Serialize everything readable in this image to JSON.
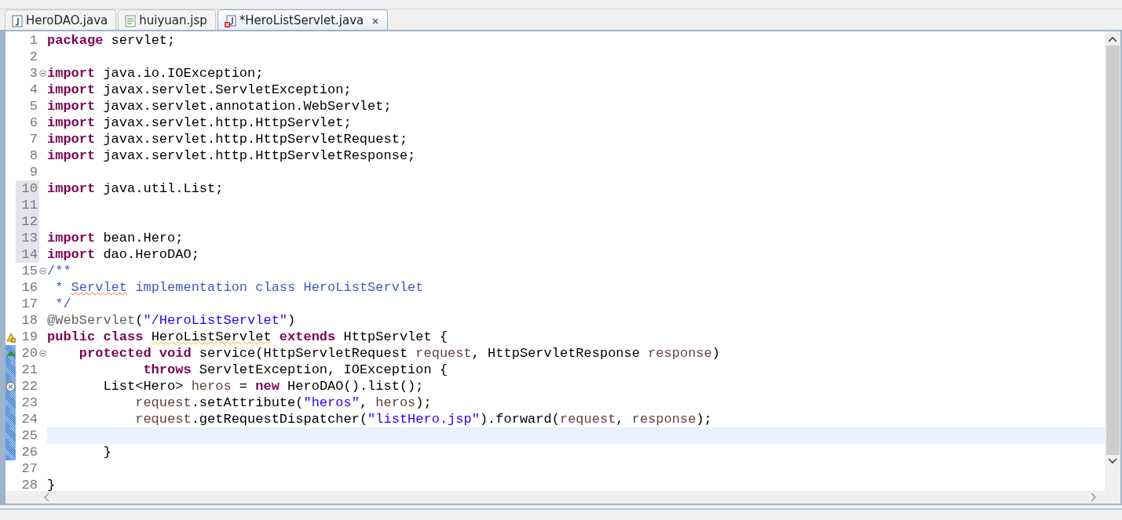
{
  "tabs": [
    {
      "label": "HeroDAO.java",
      "kind": "java",
      "selected": false,
      "closable": false
    },
    {
      "label": "huiyuan.jsp",
      "kind": "jsp",
      "selected": false,
      "closable": false
    },
    {
      "label": "*HeroListServlet.java",
      "kind": "javaerror",
      "selected": true,
      "closable": true
    }
  ],
  "editor": {
    "lines": [
      {
        "n": "1",
        "tokens": [
          {
            "kind": "keyword",
            "t": "package"
          },
          {
            "kind": "plain",
            "t": " servlet;"
          }
        ]
      },
      {
        "n": "2"
      },
      {
        "n": "3",
        "fold": true,
        "tokens": [
          {
            "kind": "keyword",
            "t": "import"
          },
          {
            "kind": "plain",
            "t": " java.io.IOException;"
          }
        ]
      },
      {
        "n": "4",
        "tokens": [
          {
            "kind": "keyword",
            "t": "import"
          },
          {
            "kind": "plain",
            "t": " javax.servlet.ServletException;"
          }
        ]
      },
      {
        "n": "5",
        "tokens": [
          {
            "kind": "keyword",
            "t": "import"
          },
          {
            "kind": "plain",
            "t": " javax.servlet.annotation.WebServlet;"
          }
        ]
      },
      {
        "n": "6",
        "tokens": [
          {
            "kind": "keyword",
            "t": "import"
          },
          {
            "kind": "plain",
            "t": " javax.servlet.http.HttpServlet;"
          }
        ]
      },
      {
        "n": "7",
        "tokens": [
          {
            "kind": "keyword",
            "t": "import"
          },
          {
            "kind": "plain",
            "t": " javax.servlet.http.HttpServletRequest;"
          }
        ]
      },
      {
        "n": "8",
        "tokens": [
          {
            "kind": "keyword",
            "t": "import"
          },
          {
            "kind": "plain",
            "t": " javax.servlet.http.HttpServletResponse;"
          }
        ]
      },
      {
        "n": "9"
      },
      {
        "n": "10",
        "shaded": true,
        "tokens": [
          {
            "kind": "keyword",
            "t": "import"
          },
          {
            "kind": "plain",
            "t": " java.util.List;"
          }
        ]
      },
      {
        "n": "11",
        "shaded": true
      },
      {
        "n": "12",
        "shaded": true
      },
      {
        "n": "13",
        "shaded": true,
        "tokens": [
          {
            "kind": "keyword",
            "t": "import"
          },
          {
            "kind": "plain",
            "t": " bean.Hero;"
          }
        ]
      },
      {
        "n": "14",
        "shaded": true,
        "tokens": [
          {
            "kind": "keyword",
            "t": "import"
          },
          {
            "kind": "plain",
            "t": " dao.HeroDAO;"
          }
        ]
      },
      {
        "n": "15",
        "fold": true,
        "tokens": [
          {
            "kind": "doc",
            "t": "/**"
          }
        ]
      },
      {
        "n": "16",
        "tokens": [
          {
            "kind": "doc",
            "t": " * "
          },
          {
            "kind": "doc",
            "t": "Servlet",
            "misspelled": true
          },
          {
            "kind": "doc",
            "t": " implementation class HeroListServlet"
          }
        ]
      },
      {
        "n": "17",
        "tokens": [
          {
            "kind": "doc",
            "t": " */"
          }
        ]
      },
      {
        "n": "18",
        "tokens": [
          {
            "kind": "annotation",
            "t": "@WebServlet"
          },
          {
            "kind": "plain",
            "t": "("
          },
          {
            "kind": "string",
            "t": "\"/HeroListServlet\""
          },
          {
            "kind": "plain",
            "t": ")"
          }
        ]
      },
      {
        "n": "19",
        "warning": true,
        "tokens": [
          {
            "kind": "keyword",
            "t": "public class "
          },
          {
            "kind": "plain",
            "t": "HeroListServlet",
            "warned": true
          },
          {
            "kind": "keyword",
            "t": " extends"
          },
          {
            "kind": "plain",
            "t": " HttpServlet {"
          }
        ]
      },
      {
        "n": "20",
        "override": true,
        "fold": true,
        "changed": true,
        "tokens": [
          {
            "kind": "keyword",
            "t": "    protected void"
          },
          {
            "kind": "plain",
            "t": " service(HttpServletRequest "
          },
          {
            "kind": "variable",
            "t": "request"
          },
          {
            "kind": "plain",
            "t": ", HttpServletResponse "
          },
          {
            "kind": "variable",
            "t": "response"
          },
          {
            "kind": "plain",
            "t": ")"
          }
        ]
      },
      {
        "n": "21",
        "changed": true,
        "tokens": [
          {
            "kind": "keyword",
            "t": "            throws"
          },
          {
            "kind": "plain",
            "t": " ServletException, IOException {"
          }
        ]
      },
      {
        "n": "22",
        "error": true,
        "changed": true,
        "tokens": [
          {
            "kind": "plain",
            "t": "       List<Hero> "
          },
          {
            "kind": "variable",
            "t": "heros"
          },
          {
            "kind": "plain",
            "t": " = "
          },
          {
            "kind": "keyword",
            "t": "new"
          },
          {
            "kind": "plain",
            "t": " HeroDAO().list();"
          }
        ]
      },
      {
        "n": "23",
        "changed": true,
        "tokens": [
          {
            "kind": "variable",
            "t": "           request"
          },
          {
            "kind": "plain",
            "t": ".setAttribute("
          },
          {
            "kind": "string",
            "t": "\"heros\""
          },
          {
            "kind": "plain",
            "t": ", "
          },
          {
            "kind": "variable",
            "t": "heros"
          },
          {
            "kind": "plain",
            "t": ");"
          }
        ]
      },
      {
        "n": "24",
        "changed": true,
        "tokens": [
          {
            "kind": "variable",
            "t": "           request"
          },
          {
            "kind": "plain",
            "t": ".getRequestDispatcher("
          },
          {
            "kind": "string",
            "t": "\"listHero.jsp\""
          },
          {
            "kind": "plain",
            "t": ").forward("
          },
          {
            "kind": "variable",
            "t": "request"
          },
          {
            "kind": "plain",
            "t": ", "
          },
          {
            "kind": "variable",
            "t": "response"
          },
          {
            "kind": "plain",
            "t": ");"
          }
        ]
      },
      {
        "n": "25",
        "current": true,
        "changed": true
      },
      {
        "n": "26",
        "changed": true,
        "tokens": [
          {
            "kind": "plain",
            "t": "       }"
          }
        ]
      },
      {
        "n": "27"
      },
      {
        "n": "28",
        "tokens": [
          {
            "kind": "plain",
            "t": "}"
          }
        ]
      }
    ]
  }
}
